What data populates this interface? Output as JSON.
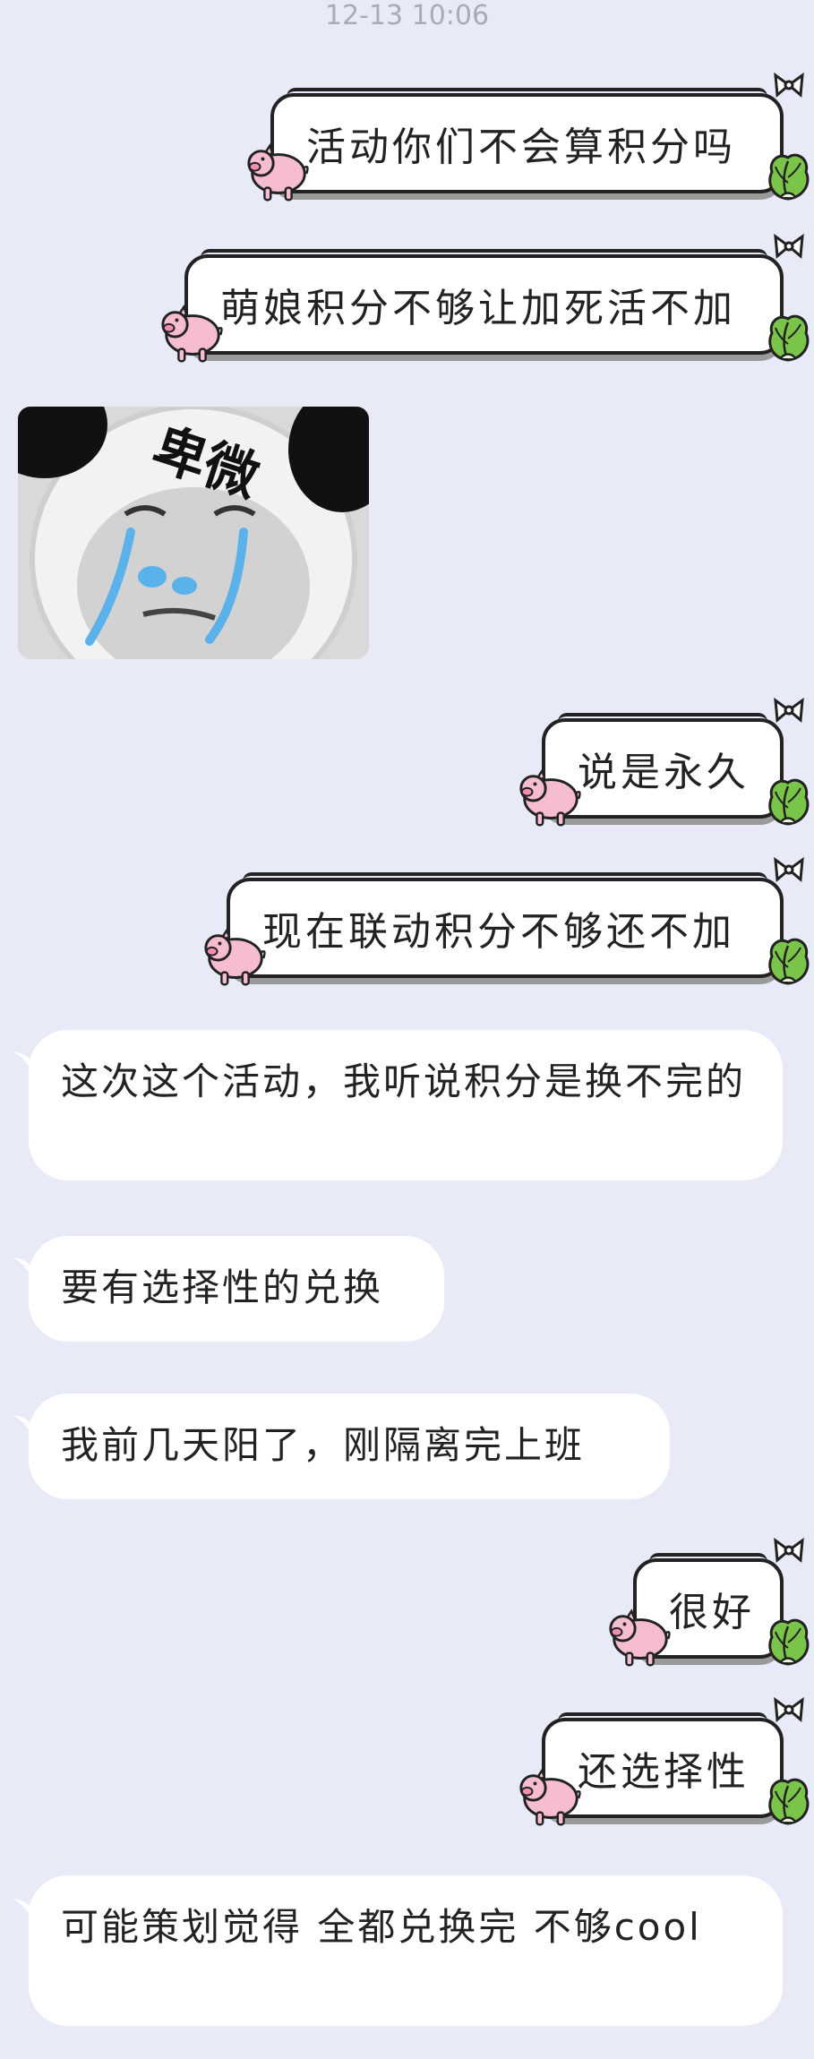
{
  "timestamp": "12-13 10:06",
  "messages": {
    "m1": "活动你们不会算积分吗",
    "m2": "萌娘积分不够让加死活不加",
    "sticker": {
      "caption": "卑微",
      "icon": "crying-panda-meme"
    },
    "m3": "说是永久",
    "m4": "现在联动积分不够还不加",
    "m5": "这次这个活动，我听说积分是换不完的",
    "m6": "要有选择性的兑换",
    "m7": "我前几天阳了，刚隔离完上班",
    "m8": "很好",
    "m9": "还选择性",
    "m10": "可能策划觉得 全都兑换完  不够cool"
  },
  "colors": {
    "background": "#e8eaf7",
    "incoming_bubble": "#ffffff",
    "pig": "#f4b5c8",
    "cabbage": "#7bc44a"
  }
}
